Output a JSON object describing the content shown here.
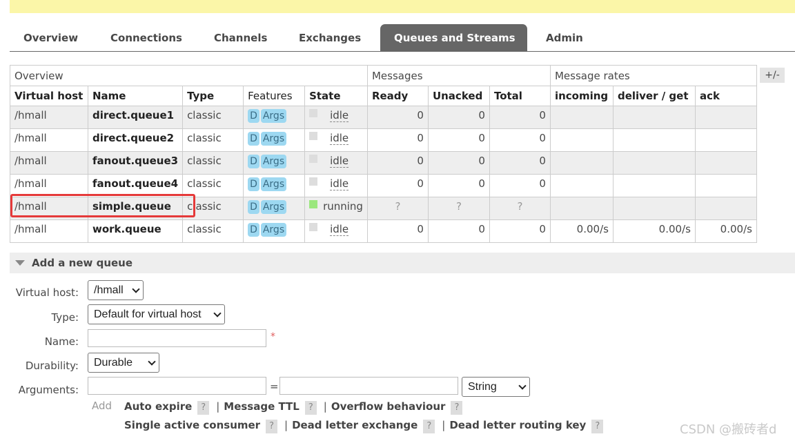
{
  "tabs": [
    {
      "label": "Overview",
      "active": false
    },
    {
      "label": "Connections",
      "active": false
    },
    {
      "label": "Channels",
      "active": false
    },
    {
      "label": "Exchanges",
      "active": false
    },
    {
      "label": "Queues and Streams",
      "active": true
    },
    {
      "label": "Admin",
      "active": false
    }
  ],
  "table": {
    "groups": {
      "overview": "Overview",
      "messages": "Messages",
      "rates": "Message rates"
    },
    "toggle_label": "+/-",
    "columns": [
      "Virtual host",
      "Name",
      "Type",
      "Features",
      "State",
      "Ready",
      "Unacked",
      "Total",
      "incoming",
      "deliver / get",
      "ack"
    ],
    "rows": [
      {
        "vhost": "/hmall",
        "name": "direct.queue1",
        "type": "classic",
        "f1": "D",
        "f2": "Args",
        "state": "idle",
        "ready": "0",
        "unacked": "0",
        "total": "0",
        "incoming": "",
        "deliver": "",
        "ack": ""
      },
      {
        "vhost": "/hmall",
        "name": "direct.queue2",
        "type": "classic",
        "f1": "D",
        "f2": "Args",
        "state": "idle",
        "ready": "0",
        "unacked": "0",
        "total": "0",
        "incoming": "",
        "deliver": "",
        "ack": ""
      },
      {
        "vhost": "/hmall",
        "name": "fanout.queue3",
        "type": "classic",
        "f1": "D",
        "f2": "Args",
        "state": "idle",
        "ready": "0",
        "unacked": "0",
        "total": "0",
        "incoming": "",
        "deliver": "",
        "ack": ""
      },
      {
        "vhost": "/hmall",
        "name": "fanout.queue4",
        "type": "classic",
        "f1": "D",
        "f2": "Args",
        "state": "idle",
        "ready": "0",
        "unacked": "0",
        "total": "0",
        "incoming": "",
        "deliver": "",
        "ack": ""
      },
      {
        "vhost": "/hmall",
        "name": "simple.queue",
        "type": "classic",
        "f1": "D",
        "f2": "Args",
        "state": "running",
        "ready": "?",
        "unacked": "?",
        "total": "?",
        "incoming": "",
        "deliver": "",
        "ack": ""
      },
      {
        "vhost": "/hmall",
        "name": "work.queue",
        "type": "classic",
        "f1": "D",
        "f2": "Args",
        "state": "idle",
        "ready": "0",
        "unacked": "0",
        "total": "0",
        "incoming": "0.00/s",
        "deliver": "0.00/s",
        "ack": "0.00/s"
      }
    ]
  },
  "add_queue": {
    "section_title": "Add a new queue",
    "virtual_host_label": "Virtual host:",
    "virtual_host_value": "/hmall",
    "type_label": "Type:",
    "type_value": "Default for virtual host",
    "name_label": "Name:",
    "name_value": "",
    "required_mark": "*",
    "durability_label": "Durability:",
    "durability_value": "Durable",
    "arguments_label": "Arguments:",
    "arg_equals": "=",
    "arg_type_value": "String",
    "add_label": "Add",
    "help_mark": "?",
    "separator": "|",
    "arg_links_row1": [
      "Auto expire",
      "Message TTL",
      "Overflow behaviour"
    ],
    "arg_links_row2": [
      "Single active consumer",
      "Dead letter exchange",
      "Dead letter routing key"
    ]
  },
  "watermark": "CSDN @搬砖者d"
}
